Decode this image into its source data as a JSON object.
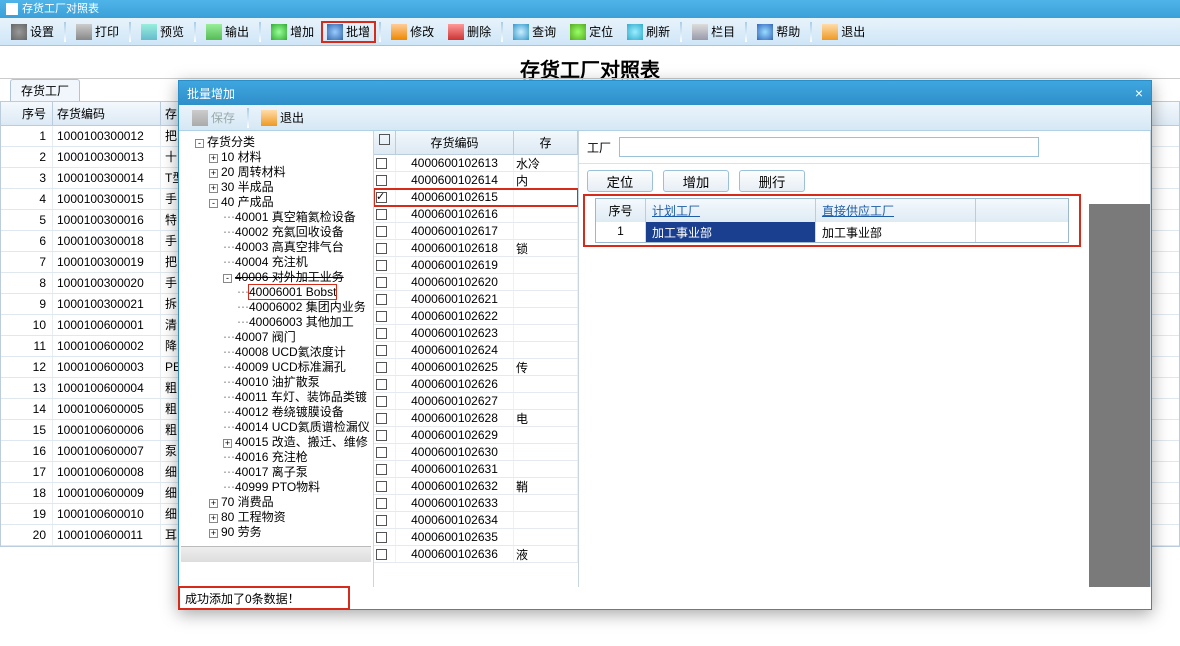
{
  "app_title": "存货工厂对照表",
  "toolbar": [
    {
      "id": "settings",
      "label": "设置",
      "icon": "i-gear"
    },
    {
      "id": "print",
      "label": "打印",
      "icon": "i-print"
    },
    {
      "id": "preview",
      "label": "预览",
      "icon": "i-preview"
    },
    {
      "id": "export",
      "label": "输出",
      "icon": "i-export"
    },
    {
      "id": "add",
      "label": "增加",
      "icon": "i-add"
    },
    {
      "id": "batch-add",
      "label": "批增",
      "icon": "i-batch",
      "hl": true
    },
    {
      "id": "edit",
      "label": "修改",
      "icon": "i-edit"
    },
    {
      "id": "delete",
      "label": "删除",
      "icon": "i-del"
    },
    {
      "id": "query",
      "label": "查询",
      "icon": "i-search"
    },
    {
      "id": "locate",
      "label": "定位",
      "icon": "i-locate"
    },
    {
      "id": "refresh",
      "label": "刷新",
      "icon": "i-refresh"
    },
    {
      "id": "columns",
      "label": "栏目",
      "icon": "i-cols"
    },
    {
      "id": "help",
      "label": "帮助",
      "icon": "i-help"
    },
    {
      "id": "exit",
      "label": "退出",
      "icon": "i-exit"
    }
  ],
  "page_title": "存货工厂对照表",
  "bg_tab": "存货工厂",
  "bg_cols": {
    "seq": "序号",
    "code": "存货编码",
    "name": "存"
  },
  "bg_rows": [
    {
      "seq": 1,
      "code": "1000100300012",
      "name": "把"
    },
    {
      "seq": 2,
      "code": "1000100300013",
      "name": "十"
    },
    {
      "seq": 3,
      "code": "1000100300014",
      "name": "T型"
    },
    {
      "seq": 4,
      "code": "1000100300015",
      "name": "手"
    },
    {
      "seq": 5,
      "code": "1000100300016",
      "name": "特"
    },
    {
      "seq": 6,
      "code": "1000100300018",
      "name": "手"
    },
    {
      "seq": 7,
      "code": "1000100300019",
      "name": "把"
    },
    {
      "seq": 8,
      "code": "1000100300020",
      "name": "手"
    },
    {
      "seq": 9,
      "code": "1000100300021",
      "name": "拆"
    },
    {
      "seq": 10,
      "code": "1000100600001",
      "name": "清"
    },
    {
      "seq": 11,
      "code": "1000100600002",
      "name": "降"
    },
    {
      "seq": 12,
      "code": "1000100600003",
      "name": "PE"
    },
    {
      "seq": 13,
      "code": "1000100600004",
      "name": "粗"
    },
    {
      "seq": 14,
      "code": "1000100600005",
      "name": "粗"
    },
    {
      "seq": 15,
      "code": "1000100600006",
      "name": "粗"
    },
    {
      "seq": 16,
      "code": "1000100600007",
      "name": "泵"
    },
    {
      "seq": 17,
      "code": "1000100600008",
      "name": "细"
    },
    {
      "seq": 18,
      "code": "1000100600009",
      "name": "细"
    },
    {
      "seq": 19,
      "code": "1000100600010",
      "name": "细"
    },
    {
      "seq": 20,
      "code": "1000100600011",
      "name": "耳"
    }
  ],
  "modal": {
    "title": "批量增加",
    "save": "保存",
    "exit": "退出",
    "status": "成功添加了0条数据！",
    "tree_root": "存货分类",
    "tree": [
      {
        "t": "10 材料",
        "exp": "+"
      },
      {
        "t": "20 周转材料",
        "exp": "+"
      },
      {
        "t": "30 半成品",
        "exp": "+"
      },
      {
        "t": "40 产成品",
        "exp": "-",
        "children": [
          {
            "t": "40001 真空箱氦检设备"
          },
          {
            "t": "40002 充氦回收设备"
          },
          {
            "t": "40003 高真空排气台"
          },
          {
            "t": "40004 充注机"
          },
          {
            "t": "40006 对外加工业务",
            "exp": "-",
            "strike": true,
            "children": [
              {
                "t": "40006001 Bobst",
                "hl": true
              },
              {
                "t": "40006002 集团内业务"
              },
              {
                "t": "40006003 其他加工"
              }
            ]
          },
          {
            "t": "40007 阀门"
          },
          {
            "t": "40008 UCD氦浓度计"
          },
          {
            "t": "40009 UCD标准漏孔"
          },
          {
            "t": "40010 油扩散泵"
          },
          {
            "t": "40011 车灯、装饰品类镀"
          },
          {
            "t": "40012 卷绕镀膜设备"
          },
          {
            "t": "40014 UCD氦质谱检漏仪"
          },
          {
            "t": "40015 改造、搬迁、维修",
            "exp": "+"
          },
          {
            "t": "40016 充注枪"
          },
          {
            "t": "40017 离子泵"
          },
          {
            "t": "40999 PTO物料"
          }
        ]
      },
      {
        "t": "70 消费品",
        "exp": "+"
      },
      {
        "t": "80 工程物资",
        "exp": "+"
      },
      {
        "t": "90 劳务",
        "exp": "+"
      }
    ],
    "code_cols": {
      "code": "存货编码",
      "name": "存"
    },
    "codes": [
      {
        "c": "4000600102613",
        "n": "水冷",
        "chk": false
      },
      {
        "c": "4000600102614",
        "n": "内",
        "chk": false
      },
      {
        "c": "4000600102615",
        "n": "",
        "chk": true,
        "hl": true
      },
      {
        "c": "4000600102616",
        "n": "",
        "chk": false
      },
      {
        "c": "4000600102617",
        "n": "",
        "chk": false
      },
      {
        "c": "4000600102618",
        "n": "锁",
        "chk": false
      },
      {
        "c": "4000600102619",
        "n": "",
        "chk": false
      },
      {
        "c": "4000600102620",
        "n": "",
        "chk": false
      },
      {
        "c": "4000600102621",
        "n": "",
        "chk": false
      },
      {
        "c": "4000600102622",
        "n": "",
        "chk": false
      },
      {
        "c": "4000600102623",
        "n": "",
        "chk": false
      },
      {
        "c": "4000600102624",
        "n": "",
        "chk": false
      },
      {
        "c": "4000600102625",
        "n": "传",
        "chk": false
      },
      {
        "c": "4000600102626",
        "n": "",
        "chk": false
      },
      {
        "c": "4000600102627",
        "n": "",
        "chk": false
      },
      {
        "c": "4000600102628",
        "n": "电",
        "chk": false
      },
      {
        "c": "4000600102629",
        "n": "",
        "chk": false
      },
      {
        "c": "4000600102630",
        "n": "",
        "chk": false
      },
      {
        "c": "4000600102631",
        "n": "",
        "chk": false
      },
      {
        "c": "4000600102632",
        "n": "鞘",
        "chk": false
      },
      {
        "c": "4000600102633",
        "n": "",
        "chk": false
      },
      {
        "c": "4000600102634",
        "n": "",
        "chk": false
      },
      {
        "c": "4000600102635",
        "n": "",
        "chk": false
      },
      {
        "c": "4000600102636",
        "n": "液",
        "chk": false
      }
    ],
    "right": {
      "factory_label": "工厂",
      "factory_value": "",
      "btn_locate": "定位",
      "btn_add": "增加",
      "btn_del": "删行",
      "grid_cols": {
        "seq": "序号",
        "plan": "计划工厂",
        "sup": "直接供应工厂"
      },
      "grid_rows": [
        {
          "seq": 1,
          "plan": "加工事业部",
          "sup": "加工事业部"
        }
      ]
    }
  }
}
